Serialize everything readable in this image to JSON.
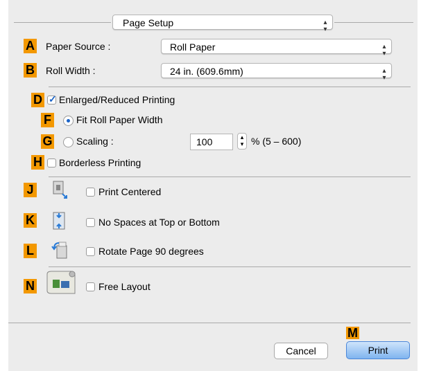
{
  "header": {
    "popup_label": "Page Setup"
  },
  "badges": {
    "A": "A",
    "B": "B",
    "D": "D",
    "F": "F",
    "G": "G",
    "H": "H",
    "J": "J",
    "K": "K",
    "L": "L",
    "N": "N",
    "M": "M"
  },
  "paper_source": {
    "label": "Paper Source :",
    "value": "Roll Paper"
  },
  "roll_width": {
    "label": "Roll Width :",
    "value": "24 in. (609.6mm)"
  },
  "enlarged": {
    "label": "Enlarged/Reduced Printing",
    "checked": true
  },
  "fit_roll": {
    "label": "Fit Roll Paper Width",
    "selected": true
  },
  "scaling": {
    "label": "Scaling :",
    "value": "100",
    "range": "% (5 – 600)"
  },
  "borderless": {
    "label": "Borderless Printing"
  },
  "print_centered": {
    "label": "Print Centered"
  },
  "no_spaces": {
    "label": "No Spaces at Top or Bottom"
  },
  "rotate": {
    "label": "Rotate Page 90 degrees"
  },
  "free_layout": {
    "label": "Free Layout"
  },
  "buttons": {
    "cancel": "Cancel",
    "print": "Print"
  },
  "colors": {
    "badge": "#f39800",
    "accent": "#1a63c7",
    "background": "#ececec"
  }
}
